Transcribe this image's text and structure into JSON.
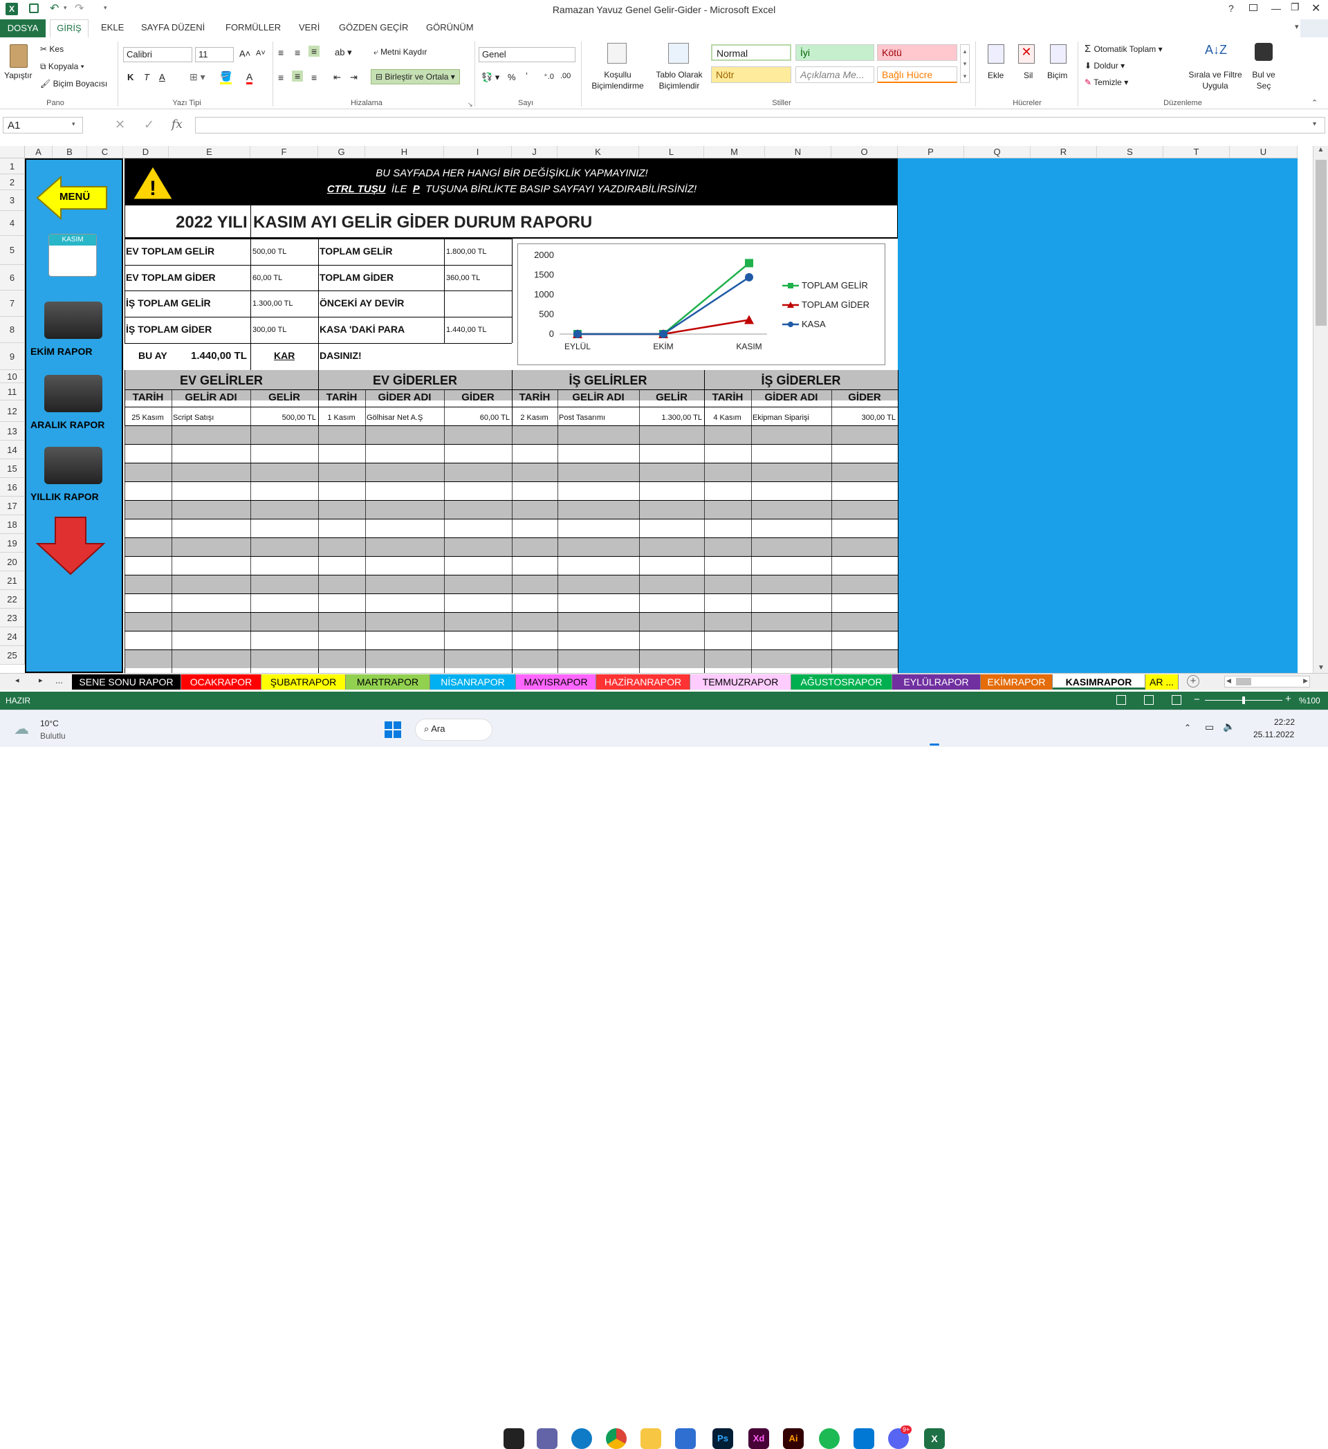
{
  "window": {
    "title": "Ramazan Yavuz Genel Gelir-Gider - Microsoft Excel",
    "help": "?"
  },
  "ribbon_tabs": [
    "DOSYA",
    "GİRİŞ",
    "EKLE",
    "SAYFA DÜZENİ",
    "FORMÜLLER",
    "VERİ",
    "GÖZDEN GEÇİR",
    "GÖRÜNÜM"
  ],
  "ribbon": {
    "pano": {
      "paste": "Yapıştır",
      "cut": "Kes",
      "copy": "Kopyala",
      "format_painter": "Biçim Boyacısı",
      "group": "Pano"
    },
    "font": {
      "name": "Calibri",
      "size": "11",
      "bold": "K",
      "italic": "T",
      "underline": "A",
      "group": "Yazı Tipi"
    },
    "align": {
      "wrap": "Metni Kaydır",
      "merge": "Birleştir ve Ortala",
      "group": "Hizalama"
    },
    "number": {
      "format": "Genel",
      "percent": "%",
      "group": "Sayı"
    },
    "styles": {
      "cond": "Koşullu Biçimlendirme",
      "table": "Tablo Olarak Biçimlendir",
      "normal": "Normal",
      "good": "İyi",
      "bad": "Kötü",
      "neutral": "Nötr",
      "explanatory": "Açıklama Me...",
      "linked": "Bağlı Hücre",
      "group": "Stiller"
    },
    "cells": {
      "insert": "Ekle",
      "delete": "Sil",
      "format": "Biçim",
      "group": "Hücreler"
    },
    "editing": {
      "autosum": "Otomatik Toplam",
      "fill": "Doldur",
      "clear": "Temizle",
      "sort": "Sırala ve Filtre Uygula",
      "find": "Bul ve Seç",
      "group": "Düzenleme"
    }
  },
  "formula_bar": {
    "name_box": "A1",
    "fx": "fx",
    "value": ""
  },
  "columns": [
    "A",
    "B",
    "C",
    "D",
    "E",
    "F",
    "G",
    "H",
    "I",
    "J",
    "K",
    "L",
    "M",
    "N",
    "O",
    "P",
    "Q",
    "R",
    "S",
    "T",
    "U"
  ],
  "rows": [
    "1",
    "2",
    "3",
    "4",
    "5",
    "6",
    "7",
    "8",
    "9",
    "10",
    "11",
    "12",
    "13",
    "14",
    "15",
    "16",
    "17",
    "18",
    "19",
    "20",
    "21",
    "22",
    "23",
    "24",
    "25"
  ],
  "sidebar": {
    "menu": "MENÜ",
    "calendar_month": "KASIM",
    "ekim": "EKİM RAPOR",
    "aralik": "ARALIK RAPOR",
    "yillik": "YILLIK RAPOR"
  },
  "banner": {
    "line1": "BU SAYFADA HER HANGİ BİR DEĞİŞİKLİK YAPMAYINIZ!",
    "ctrl": "CTRL TUŞU",
    "ile": "İLE",
    "p": "P",
    "line2_rest": "TUŞUNA BİRLİKTE BASIP SAYFAYI YAZDIRABİLİRSİNİZ!"
  },
  "report_title_year": "2022 YILI",
  "report_title": "KASIM AYI GELİR GİDER DURUM RAPORU",
  "summary": [
    {
      "label": "EV TOPLAM GELİR",
      "value": "500,00 TL",
      "label2": "TOPLAM GELİR",
      "value2": "1.800,00 TL"
    },
    {
      "label": "EV TOPLAM GİDER",
      "value": "60,00 TL",
      "label2": "TOPLAM GİDER",
      "value2": "360,00 TL"
    },
    {
      "label": "İŞ TOPLAM GELİR",
      "value": "1.300,00 TL",
      "label2": "ÖNCEKİ AY DEVİR",
      "value2": ""
    },
    {
      "label": "İŞ TOPLAM GİDER",
      "value": "300,00 TL",
      "label2": "KASA 'DAKİ PARA",
      "value2": "1.440,00 TL"
    }
  ],
  "bu_ay": {
    "label": "BU AY",
    "value": "1.440,00 TL",
    "status": "KAR",
    "msg": "DASINIZ!"
  },
  "sections": [
    "EV GELİRLER",
    "EV GİDERLER",
    "İŞ GELİRLER",
    "İŞ GİDERLER"
  ],
  "subheaders": [
    "TARİH",
    "GELİR ADI",
    "GELİR",
    "TARİH",
    "GİDER ADI",
    "GİDER",
    "TARİH",
    "GELİR ADI",
    "GELİR",
    "TARİH",
    "GİDER ADI",
    "GİDER"
  ],
  "entries": [
    "25 Kasım",
    "Script Satışı",
    "500,00 TL",
    "1 Kasım",
    "Gölhisar Net A.Ş",
    "60,00 TL",
    "2 Kasım",
    "Post Tasarımı",
    "1.300,00 TL",
    "4 Kasım",
    "Ekipman Siparişi",
    "300,00 TL"
  ],
  "chart_data": {
    "type": "line",
    "categories": [
      "EYLÜL",
      "EKİM",
      "KASIM"
    ],
    "series": [
      {
        "name": "TOPLAM GELİR",
        "values": [
          0,
          0,
          1800
        ],
        "color": "#1fb14c"
      },
      {
        "name": "TOPLAM GİDER",
        "values": [
          0,
          0,
          360
        ],
        "color": "#c00000"
      },
      {
        "name": "KASA",
        "values": [
          0,
          0,
          1440
        ],
        "color": "#1f5aa6"
      }
    ],
    "yticks": [
      "0",
      "500",
      "1000",
      "1500",
      "2000"
    ],
    "ylim": [
      0,
      2000
    ],
    "legend": "right"
  },
  "sheet_tabs": [
    {
      "label": "SENE SONU RAPOR",
      "bg": "#000000",
      "fg": "#ffffff"
    },
    {
      "label": "OCAKRAPOR",
      "bg": "#ff0000",
      "fg": "#ffffff"
    },
    {
      "label": "ŞUBATRAPOR",
      "bg": "#ffff00",
      "fg": "#000000"
    },
    {
      "label": "MARTRAPOR",
      "bg": "#92d050",
      "fg": "#000000"
    },
    {
      "label": "NİSANRAPOR",
      "bg": "#00b0f0",
      "fg": "#ffffff"
    },
    {
      "label": "MAYISRAPOR",
      "bg": "#ff66ff",
      "fg": "#000000"
    },
    {
      "label": "HAZİRANRAPOR",
      "bg": "#ff3333",
      "fg": "#ffffff"
    },
    {
      "label": "TEMMUZRAPOR",
      "bg": "#ffccff",
      "fg": "#000000"
    },
    {
      "label": "AĞUSTOSRAPOR",
      "bg": "#00b050",
      "fg": "#ffffff"
    },
    {
      "label": "EYLÜLRAPOR",
      "bg": "#7030a0",
      "fg": "#ffffff"
    },
    {
      "label": "EKİMRAPOR",
      "bg": "#e46c0a",
      "fg": "#ffffff"
    },
    {
      "label": "KASIMRAPOR",
      "bg": "#ffffff",
      "fg": "#000000"
    },
    {
      "label": "AR ...",
      "bg": "#ffff00",
      "fg": "#000000"
    }
  ],
  "status": {
    "ready": "HAZIR",
    "zoom": "%100"
  },
  "taskbar": {
    "temp": "10°C",
    "weather": "Bulutlu",
    "search": "Ara",
    "time": "22:22",
    "date": "25.11.2022",
    "badge": "9+"
  }
}
